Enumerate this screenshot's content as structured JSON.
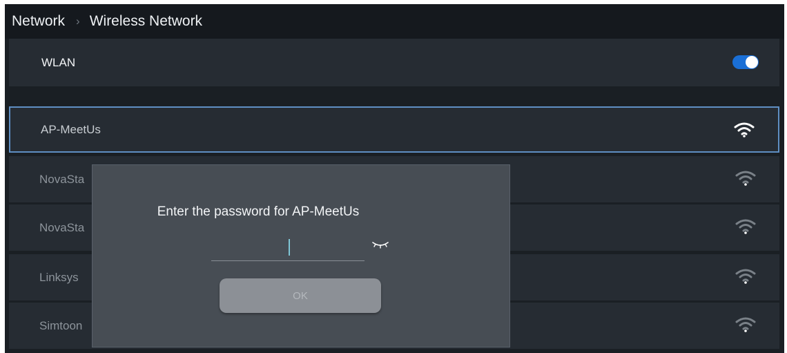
{
  "breadcrumb": {
    "parent": "Network",
    "separator": "›",
    "current": "Wireless Network"
  },
  "wlan": {
    "label": "WLAN",
    "enabled": true,
    "toggle_color": "#1a6fd6"
  },
  "networks": [
    {
      "name": "AP-MeetUs",
      "selected": true,
      "icon": "wifi-icon"
    },
    {
      "name": "NovaSta",
      "selected": false,
      "icon": "wifi-icon"
    },
    {
      "name": "NovaSta",
      "selected": false,
      "icon": "wifi-icon"
    },
    {
      "name": "Linksys",
      "selected": false,
      "icon": "wifi-icon"
    },
    {
      "name": "Simtoon",
      "selected": false,
      "icon": "wifi-icon"
    }
  ],
  "dialog": {
    "title": "Enter the password for AP-MeetUs",
    "password_value": "",
    "visibility_icon": "eye-closed-icon",
    "ok_label": "OK"
  },
  "colors": {
    "selected_border": "#5f8fc4",
    "background": "#1a1f24",
    "row": "#262c33"
  }
}
